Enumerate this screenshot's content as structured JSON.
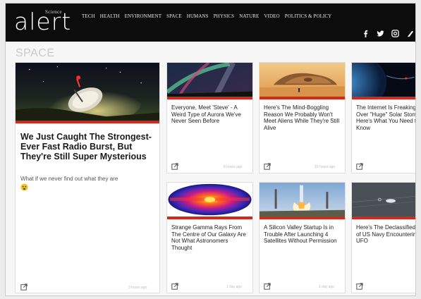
{
  "brand": {
    "small": "Science",
    "main": "alert"
  },
  "nav": [
    "Tech",
    "Health",
    "Environment",
    "Space",
    "Humans",
    "Physics",
    "Nature",
    "Video",
    "Politics & Policy"
  ],
  "social": [
    "facebook-icon",
    "twitter-icon",
    "instagram-icon",
    "more-icon"
  ],
  "section_title": "SPACE",
  "featured": {
    "title": "We Just Caught The Strongest-Ever Fast Radio Burst, But They're Still Super Mysterious",
    "subtitle": "What if we never find out what they are",
    "timestamp": "3 hours ago"
  },
  "articles": [
    {
      "title": "Everyone, Meet 'Steve' - A Weird Type of Aurora We've Never Seen Before",
      "timestamp": "8 hours ago"
    },
    {
      "title": "Here's The Mind-Boggling Reason We Probably Won't Meet Aliens While They're Still Alive",
      "timestamp": "10 hours ago"
    },
    {
      "title": "The Internet Is Freaking Out Over \"Huge\" Solar Storm Here's What You Need to Know",
      "timestamp": ""
    },
    {
      "title": "Strange Gamma Rays From The Centre of Our Galaxy Are Not What Astronomers Thought",
      "timestamp": "1 day ago"
    },
    {
      "title": "A Silicon Valley Startup Is in Trouble After Launching 4 Satellites Without Permission",
      "timestamp": "1 day ago"
    },
    {
      "title": "Here's The Declassified Video of US Navy Encountering a UFO",
      "timestamp": ""
    }
  ],
  "colors": {
    "accent": "#d8261b",
    "topbar": "#0c0c0c"
  }
}
